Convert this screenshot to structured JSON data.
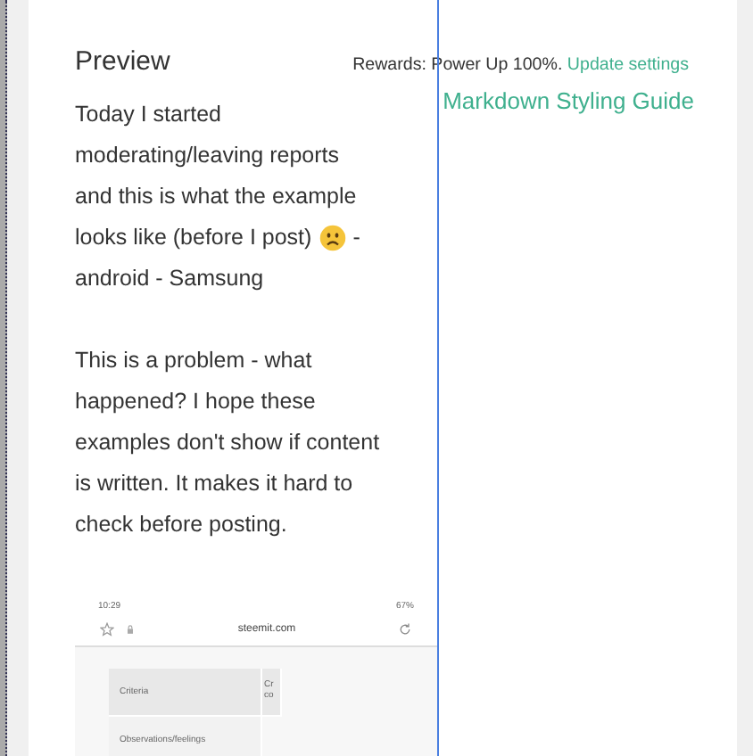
{
  "preview": {
    "title": "Preview",
    "rewards_text": "Rewards: Power Up 100%.",
    "rewards_link": "Update settings",
    "guide_link": "Markdown Styling Guide",
    "paragraph_1": [
      {
        "text": "Today I started"
      },
      {
        "text": "moderating/leaving reports"
      },
      {
        "text": "and this is what the example"
      },
      {
        "kind": "emoji",
        "text": "looks like (before I post)",
        "tail": "-"
      },
      {
        "text": "android - Samsung"
      }
    ],
    "paragraph_2": [
      "This is a problem - what",
      "happened? I hope these",
      "examples don't show if content",
      "is written. It makes it hard to",
      "check before posting."
    ]
  },
  "phone_screenshot": {
    "status_time": "10:29",
    "battery": "67%",
    "url": "steemit.com",
    "table": [
      [
        "Criteria",
        "Cr co"
      ],
      [
        "Observations/feelings"
      ]
    ]
  }
}
